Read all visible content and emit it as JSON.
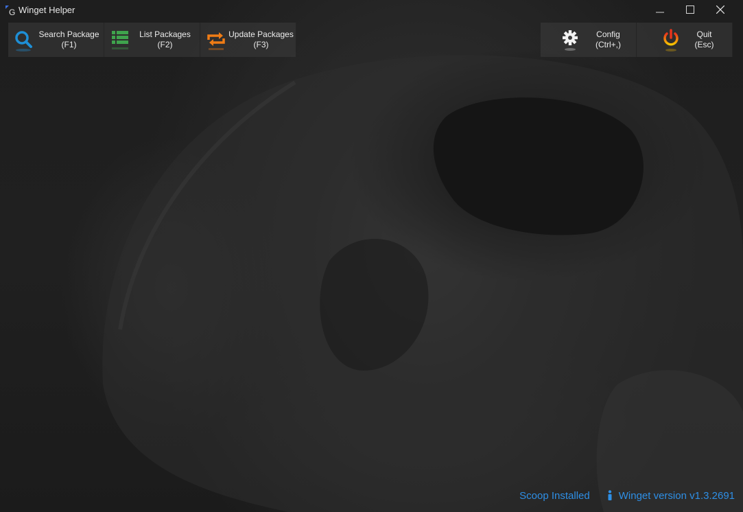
{
  "window": {
    "title": "Winget Helper",
    "app_icon_letter": "G",
    "controls": [
      "minimize",
      "maximize",
      "close"
    ]
  },
  "toolbar_left": [
    {
      "label": "Search Package",
      "shortcut": "(F1)",
      "icon": "search-icon",
      "color": "#1e8fd6"
    },
    {
      "label": "List Packages",
      "shortcut": "(F2)",
      "icon": "list-icon",
      "color": "#3fa34d"
    },
    {
      "label": "Update Packages",
      "shortcut": "(F3)",
      "icon": "refresh-icon",
      "color": "#f07c15"
    }
  ],
  "toolbar_right": [
    {
      "label": "Config",
      "shortcut": "(Ctrl+,)",
      "icon": "gear-icon",
      "color": "#f2f2f2"
    },
    {
      "label": "Quit",
      "shortcut": "(Esc)",
      "icon": "power-icon",
      "color": "#f5b800"
    }
  ],
  "status": {
    "scoop": "Scoop Installed",
    "winget": "Winget version v1.3.2691",
    "accent": "#2e8fe6"
  }
}
